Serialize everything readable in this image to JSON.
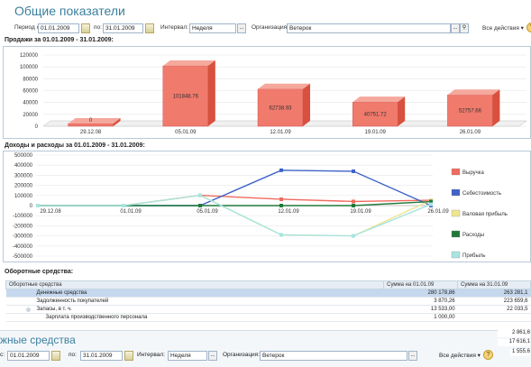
{
  "title": "Общие показатели",
  "filters": {
    "period_from_label": "Период с:",
    "period_from": "01.01.2009",
    "period_to_label": "по:",
    "period_to": "31.01.2009",
    "interval_label": "Интервал:",
    "interval": "Неделя",
    "org_label": "Организация:",
    "org": "Ветерок",
    "all_actions": "Все действия ▾"
  },
  "sales": {
    "section_title": "Продажи за 01.01.2009 - 31.01.2009:",
    "value_labels": [
      "0",
      "101848.76",
      "62738.93",
      "40751.72",
      "52757.66"
    ]
  },
  "income": {
    "section_title": "Доходы и расходы за 01.01.2009 - 31.01.2009:",
    "tick_labels": [
      "29.12.08",
      "01.01.09",
      "05.01.09",
      "12.01.09",
      "19.01.09",
      "26.01.09"
    ]
  },
  "chart_data": [
    {
      "type": "bar",
      "categories": [
        "29.12.08",
        "05.01.09",
        "12.01.09",
        "19.01.09",
        "26.01.09"
      ],
      "values": [
        0,
        101848.76,
        62738.93,
        40751.72,
        52757.66
      ],
      "ylim": [
        0,
        120000
      ],
      "yticks": [
        "120000",
        "100000",
        "80000",
        "60000",
        "40000",
        "20000",
        "0"
      ],
      "color": "#f07a6c"
    },
    {
      "type": "line",
      "x": [
        "29.12.08",
        "01.01.09",
        "05.01.09",
        "12.01.09",
        "19.01.09",
        "26.01.09"
      ],
      "ylim": [
        -500000,
        500000
      ],
      "yticks": [
        "500000",
        "400000",
        "300000",
        "200000",
        "100000",
        "0",
        "-100000",
        "-200000",
        "-300000",
        "-400000",
        "-500000"
      ],
      "series": [
        {
          "name": "Выручка",
          "color": "#f06a5e",
          "values": [
            0,
            0,
            101848.76,
            62738.93,
            40751.72,
            52757.66
          ]
        },
        {
          "name": "Себестоимость",
          "color": "#3f63c8",
          "values": [
            0,
            0,
            0,
            350000,
            340000,
            0
          ]
        },
        {
          "name": "Валовая прибыль",
          "color": "#eee58e",
          "values": [
            0,
            0,
            101848.76,
            -290000,
            -300000,
            52757.66
          ]
        },
        {
          "name": "Расходы",
          "color": "#1f7a3a",
          "values": [
            0,
            0,
            0,
            0,
            0,
            40000
          ]
        },
        {
          "name": "Прибыль",
          "color": "#a8e4e0",
          "values": [
            0,
            0,
            101848.76,
            -290000,
            -300000,
            12757.66
          ]
        }
      ],
      "legend": "right"
    }
  ],
  "assets": {
    "section_title": "Оборотные средства:",
    "columns": [
      "Оборотные средства",
      "Сумма на 01.01.09",
      "Сумма на 31.01.09"
    ],
    "rows": [
      {
        "name": "Денежные средства",
        "v1": "280 178,86",
        "v2": "263 281,1"
      },
      {
        "name": "Задолженность покупателей",
        "v1": "3 870,26",
        "v2": "223 659,6"
      },
      {
        "name": "Запасы, в т. ч.",
        "v1": "13 533,00",
        "v2": "22 033,5"
      },
      {
        "name": "Зарплата производственного персонала",
        "v1": "1 000,00",
        "v2": ""
      }
    ]
  },
  "bottom": {
    "title": "жные средства",
    "from_label": "с:",
    "from": "01.01.2009",
    "to_label": "по:",
    "to": "31.01.2009",
    "interval_label": "Интервал:",
    "interval": "Неделя",
    "org_label": "Организация:",
    "org": "Ветерок",
    "all_actions": "Все действия ▾",
    "side_values": [
      "2 861,6",
      "17 616,1",
      "1 555,6"
    ]
  }
}
